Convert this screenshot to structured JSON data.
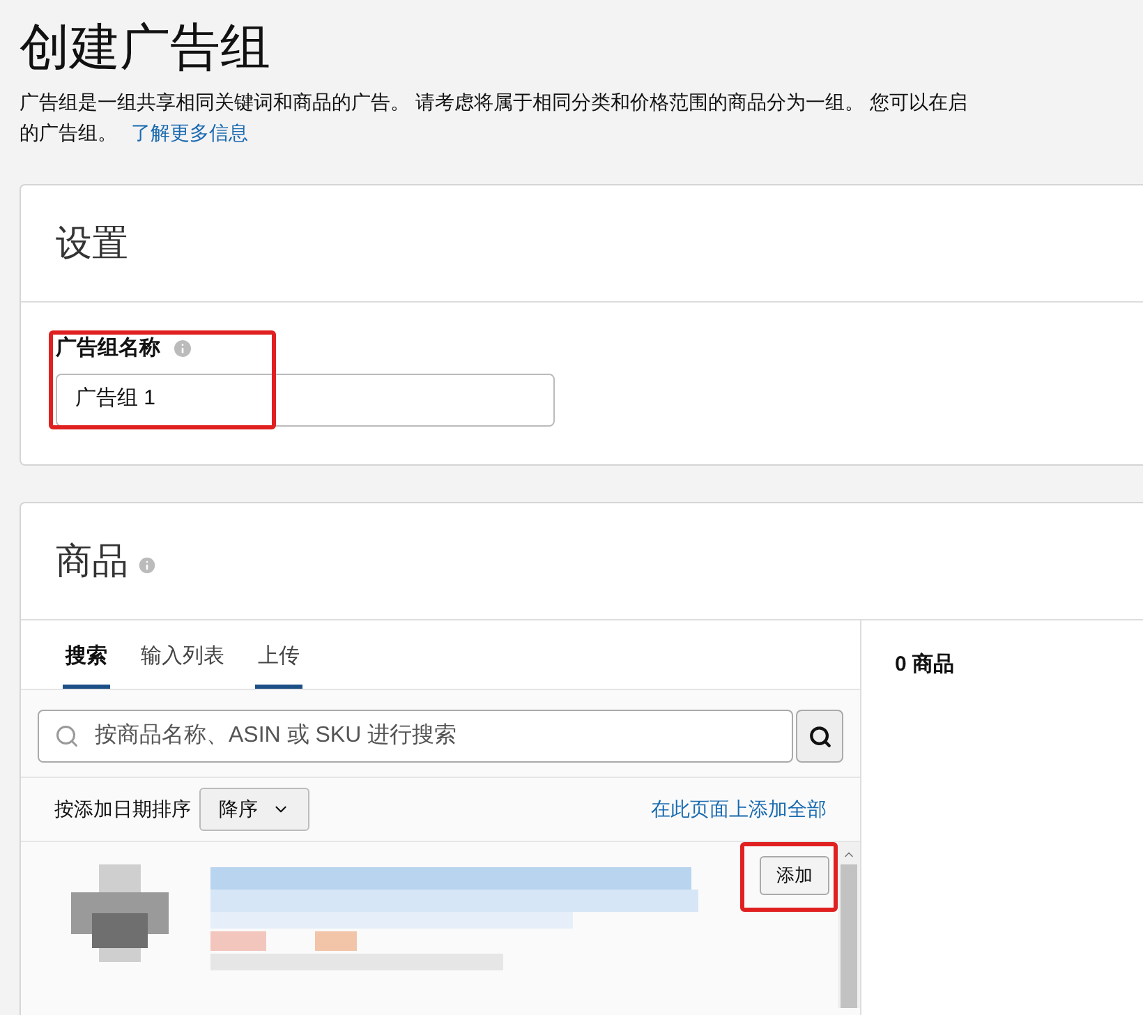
{
  "page": {
    "title": "创建广告组",
    "description_lines": [
      "广告组是一组共享相同关键词和商品的广告。 请考虑将属于相同分类和价格范围的商品分为一组。 您可以在启",
      "的广告组。"
    ],
    "learn_more_link": "了解更多信息"
  },
  "settings": {
    "title": "设置",
    "field_label": "广告组名称",
    "field_value": "广告组 1",
    "highlighted": true
  },
  "products": {
    "title": "商品",
    "tabs": [
      {
        "label": "搜索",
        "selected": true,
        "underlined": true
      },
      {
        "label": "输入列表",
        "selected": false,
        "underlined": false
      },
      {
        "label": "上传",
        "selected": false,
        "underlined": true
      }
    ],
    "search": {
      "placeholder": "按商品名称、ASIN 或 SKU 进行搜索"
    },
    "sort_label": "按添加日期排序",
    "sort_value": "降序",
    "add_all_link": "在此页面上添加全部",
    "items": [
      {
        "kind": "picture",
        "add_button": "添加",
        "highlighted": true
      }
    ],
    "count": "0 商品"
  }
}
